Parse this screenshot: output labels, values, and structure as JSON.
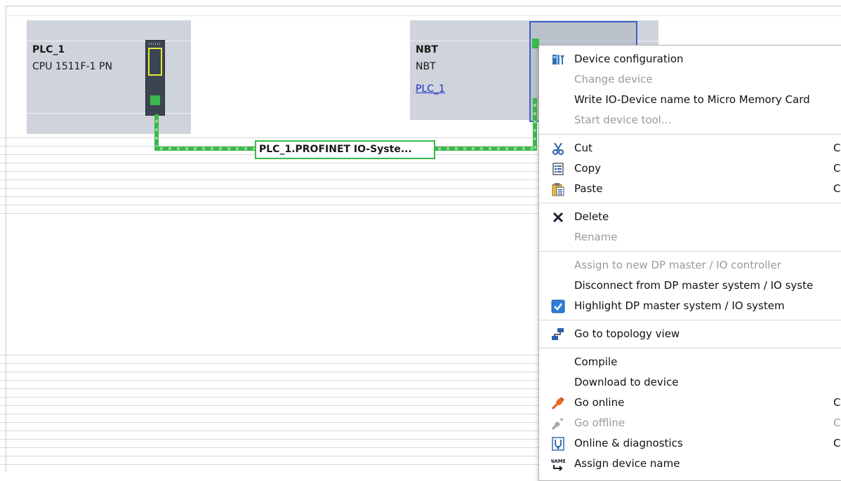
{
  "devices": {
    "plc": {
      "name": "PLC_1",
      "type": "CPU 1511F-1 PN"
    },
    "nbt": {
      "name": "NBT",
      "type": "NBT",
      "link": "PLC_1"
    }
  },
  "network": {
    "label": "PLC_1.PROFINET IO-Syste..."
  },
  "context_menu": {
    "items": [
      {
        "label": "Device configuration",
        "icon": "device-configuration-icon",
        "enabled": true
      },
      {
        "label": "Change device",
        "enabled": false
      },
      {
        "label": "Write IO-Device name to Micro Memory Card",
        "enabled": true
      },
      {
        "label": "Start device tool...",
        "enabled": false
      },
      {
        "label": "Cut",
        "icon": "scissors-icon",
        "shortcut": "C",
        "enabled": true
      },
      {
        "label": "Copy",
        "icon": "copy-icon",
        "shortcut": "C",
        "enabled": true
      },
      {
        "label": "Paste",
        "icon": "paste-icon",
        "shortcut": "C",
        "enabled": true
      },
      {
        "label": "Delete",
        "icon": "delete-x-icon",
        "enabled": true
      },
      {
        "label": "Rename",
        "enabled": false
      },
      {
        "label": "Assign to new DP master / IO controller",
        "enabled": false
      },
      {
        "label": "Disconnect from DP master system / IO syste",
        "enabled": true
      },
      {
        "label": "Highlight DP master system / IO system",
        "icon": "checkbox-checked-icon",
        "enabled": true,
        "checked": true
      },
      {
        "label": "Go to topology view",
        "icon": "topology-icon",
        "enabled": true
      },
      {
        "label": "Compile",
        "enabled": true
      },
      {
        "label": "Download to device",
        "enabled": true
      },
      {
        "label": "Go online",
        "icon": "go-online-icon",
        "shortcut": "C",
        "enabled": true
      },
      {
        "label": "Go offline",
        "icon": "go-offline-icon",
        "shortcut": "C",
        "enabled": false
      },
      {
        "label": "Online & diagnostics",
        "icon": "diagnostics-icon",
        "shortcut": "C",
        "enabled": true
      },
      {
        "label": "Assign device name",
        "icon": "assign-name-icon",
        "enabled": true
      }
    ]
  },
  "colors": {
    "device_bg": "#cfd3db",
    "network_green": "#3bb84b",
    "selection_blue": "#3a62c7",
    "link_blue": "#1a2ec2",
    "disabled_text": "#9a9a9a"
  }
}
